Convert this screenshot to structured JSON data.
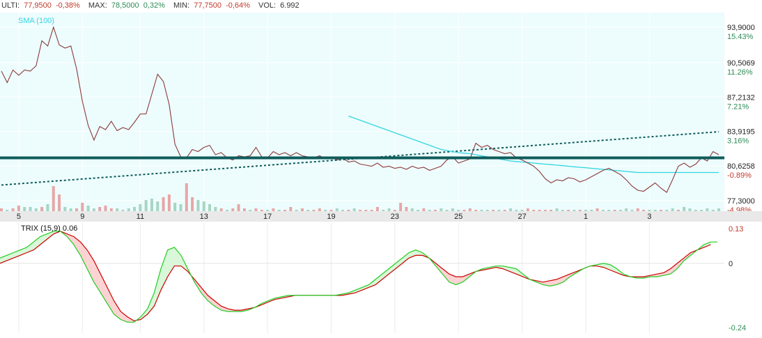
{
  "header": {
    "last_label": "ULTI:",
    "last_value": "77,9500",
    "last_change": "-0,38%",
    "max_label": "MAX:",
    "max_value": "78,5000",
    "max_change": "0,32%",
    "min_label": "MIN:",
    "min_value": "77,7500",
    "min_change": "-0,64%",
    "vol_label": "VOL:",
    "vol_value": "6.992"
  },
  "colors": {
    "down": "#c0392b",
    "up": "#2e8b57",
    "price_line": "#8b3a3a",
    "sma": "#33d6e0",
    "trend_line": "#0f5c5c",
    "support_line": "#0f5c5c",
    "plot_bg": "#edfcfd",
    "trix": "#22cc22",
    "trix_signal": "#cc0000",
    "fill_up": "#d9f7d9",
    "fill_down": "#fbd3d3",
    "vol_up": "#a8d5c3",
    "vol_down": "#e8a6a6"
  },
  "chart_data": [
    {
      "type": "line",
      "title": "",
      "sma_label": "SMA (100)",
      "x_tick_labels": [
        "5",
        "9",
        "11",
        "13",
        "17",
        "19",
        "23",
        "25",
        "27",
        "1",
        "3"
      ],
      "x_tick_index": [
        3,
        14,
        24,
        35,
        46,
        57,
        68,
        79,
        90,
        101,
        112
      ],
      "ylim": [
        76.3,
        95.3
      ],
      "y_ticks": [
        {
          "value": 93.9,
          "label": "93,9000",
          "pct": "15.43%"
        },
        {
          "value": 90.5069,
          "label": "90,5069",
          "pct": "11.26%"
        },
        {
          "value": 87.2132,
          "label": "87,2132",
          "pct": "7.21%"
        },
        {
          "value": 83.9195,
          "label": "83,9195",
          "pct": "3.16%"
        },
        {
          "value": 80.6258,
          "label": "80,6258",
          "pct": "-0.89%"
        },
        {
          "value": 77.3,
          "label": "77,3000",
          "pct": "-4.98%"
        }
      ],
      "price": [
        89.7,
        88.6,
        89.8,
        89.3,
        89.8,
        89.7,
        90.2,
        92.6,
        92.1,
        93.9,
        92.2,
        91.9,
        92.1,
        89.9,
        86.8,
        84.5,
        83.1,
        84.4,
        84.1,
        84.9,
        84.0,
        84.3,
        84.1,
        84.8,
        85.6,
        85.6,
        87.5,
        89.4,
        88.7,
        86.5,
        82.7,
        81.5,
        81.4,
        82.2,
        82.0,
        82.4,
        82.6,
        81.7,
        81.9,
        81.4,
        81.2,
        81.6,
        81.5,
        81.6,
        82.4,
        81.5,
        81.4,
        82.0,
        81.7,
        81.9,
        81.6,
        81.9,
        81.6,
        81.5,
        81.4,
        81.6,
        81.3,
        81.5,
        81.2,
        81.4,
        81.0,
        81.1,
        80.8,
        80.7,
        80.6,
        80.9,
        80.5,
        80.6,
        80.4,
        80.5,
        80.3,
        80.6,
        80.4,
        80.5,
        80.2,
        80.4,
        80.6,
        81.2,
        81.5,
        80.9,
        81.1,
        81.3,
        82.8,
        82.4,
        82.6,
        82.2,
        82.0,
        81.8,
        81.9,
        81.4,
        81.2,
        80.9,
        80.6,
        80.1,
        79.4,
        79.0,
        79.3,
        79.2,
        79.5,
        79.4,
        79.1,
        79.3,
        79.6,
        79.9,
        80.2,
        80.4,
        80.1,
        79.8,
        79.3,
        78.7,
        78.3,
        78.2,
        78.6,
        79.0,
        78.5,
        78.1,
        79.3,
        80.6,
        80.9,
        80.5,
        80.8,
        81.4,
        81.1,
        82.0,
        81.7
      ],
      "sma": [
        null,
        null,
        null,
        null,
        null,
        null,
        null,
        null,
        null,
        null,
        null,
        null,
        null,
        null,
        null,
        null,
        null,
        null,
        null,
        null,
        null,
        null,
        null,
        null,
        null,
        null,
        null,
        null,
        null,
        null,
        null,
        null,
        null,
        null,
        null,
        null,
        null,
        null,
        null,
        null,
        null,
        null,
        null,
        null,
        null,
        null,
        null,
        null,
        null,
        null,
        null,
        null,
        null,
        null,
        null,
        null,
        null,
        null,
        null,
        null,
        85.4,
        85.2,
        85.0,
        84.8,
        84.6,
        84.4,
        84.2,
        84.0,
        83.8,
        83.6,
        83.4,
        83.2,
        83.0,
        82.8,
        82.6,
        82.4,
        82.2,
        82.1,
        82.0,
        81.9,
        81.85,
        81.8,
        81.7,
        81.6,
        81.5,
        81.4,
        81.3,
        81.2,
        81.1,
        81.05,
        81.0,
        80.95,
        80.9,
        80.85,
        80.8,
        80.75,
        80.7,
        80.65,
        80.6,
        80.55,
        80.5,
        80.45,
        80.4,
        80.35,
        80.3,
        80.25,
        80.2,
        80.15,
        80.1,
        80.05,
        80.0,
        80.0,
        80.0,
        80.0,
        80.0,
        80.0,
        80.0,
        80.0,
        80.0,
        80.0,
        80.0,
        80.0,
        80.0,
        80.0,
        80.0
      ],
      "trend_line": [
        [
          0,
          78.8
        ],
        [
          124,
          83.9
        ]
      ],
      "support_level": 81.4,
      "volume": [
        2,
        1,
        2,
        4,
        3,
        3,
        2,
        3,
        5,
        18,
        12,
        3,
        2,
        2,
        6,
        4,
        2,
        3,
        4,
        2,
        2,
        1,
        2,
        3,
        5,
        8,
        9,
        7,
        10,
        12,
        6,
        5,
        20,
        10,
        8,
        7,
        5,
        3,
        2,
        1,
        2,
        5,
        2,
        1,
        2,
        1,
        1,
        2,
        1,
        1,
        3,
        1,
        2,
        1,
        1,
        2,
        1,
        1,
        2,
        1,
        1,
        2,
        1,
        1,
        1,
        3,
        1,
        2,
        1,
        6,
        3,
        2,
        1,
        2,
        1,
        1,
        2,
        1,
        2,
        1,
        1,
        2,
        1,
        1,
        1,
        1,
        1,
        1,
        2,
        1,
        1,
        2,
        1,
        1,
        1,
        1,
        2,
        1,
        1,
        1,
        1,
        1,
        1,
        2,
        1,
        1,
        1,
        1,
        2,
        1,
        2,
        1,
        1,
        1,
        1,
        1,
        2,
        1,
        3,
        2,
        1,
        1,
        2,
        1,
        2
      ],
      "volume_up": [
        false,
        true,
        false,
        false,
        true,
        true,
        true,
        false,
        true,
        false,
        false,
        true,
        true,
        false,
        false,
        true,
        true,
        false,
        false,
        false,
        true,
        true,
        true,
        true,
        true,
        true,
        true,
        true,
        false,
        false,
        true,
        true,
        false,
        false,
        true,
        true,
        true,
        true,
        false,
        true,
        false,
        false,
        false,
        true,
        false,
        false,
        true,
        false,
        true,
        false,
        false,
        true,
        false,
        true,
        false,
        false,
        true,
        false,
        true,
        true,
        false,
        true,
        false,
        false,
        false,
        false,
        true,
        true,
        false,
        false,
        false,
        true,
        true,
        false,
        true,
        false,
        true,
        true,
        true,
        true,
        false,
        false,
        false,
        true,
        true,
        false,
        true,
        false,
        true,
        true,
        true,
        false,
        false,
        false,
        false,
        false,
        true,
        true,
        false,
        true,
        false,
        true,
        true,
        false,
        true,
        true,
        false,
        true,
        true,
        true,
        false,
        false,
        true,
        true,
        false,
        true,
        true,
        false,
        true,
        true,
        true,
        true,
        true,
        true,
        true
      ]
    },
    {
      "type": "line",
      "title": "TRIX (15,9) 0.06",
      "ylim": [
        -0.24,
        0.13
      ],
      "y_tick_labels": [
        {
          "value": 0.13,
          "label": "0.13"
        },
        {
          "value": 0,
          "label": "0"
        },
        {
          "value": -0.24,
          "label": "-0.24"
        }
      ],
      "series": [
        {
          "name": "",
          "values": [
            0.02,
            0.03,
            0.04,
            0.05,
            0.06,
            0.08,
            0.1,
            0.11,
            0.12,
            0.12,
            0.1,
            0.07,
            0.03,
            -0.02,
            -0.07,
            -0.11,
            -0.15,
            -0.19,
            -0.21,
            -0.22,
            -0.22,
            -0.2,
            -0.17,
            -0.11,
            -0.02,
            0.05,
            0.06,
            0.03,
            -0.02,
            -0.07,
            -0.11,
            -0.14,
            -0.16,
            -0.175,
            -0.18,
            -0.18,
            -0.18,
            -0.175,
            -0.165,
            -0.15,
            -0.14,
            -0.13,
            -0.125,
            -0.12,
            -0.12,
            -0.12,
            -0.12,
            -0.12,
            -0.12,
            -0.12,
            -0.12,
            -0.115,
            -0.11,
            -0.1,
            -0.09,
            -0.08,
            -0.06,
            -0.04,
            -0.02,
            0.0,
            0.02,
            0.04,
            0.05,
            0.04,
            0.02,
            -0.01,
            -0.04,
            -0.07,
            -0.08,
            -0.07,
            -0.05,
            -0.03,
            -0.02,
            -0.015,
            -0.01,
            -0.01,
            -0.015,
            -0.02,
            -0.04,
            -0.06,
            -0.07,
            -0.08,
            -0.085,
            -0.08,
            -0.07,
            -0.05,
            -0.035,
            -0.02,
            -0.01,
            -0.005,
            -0.0,
            -0.005,
            -0.02,
            -0.04,
            -0.05,
            -0.055,
            -0.055,
            -0.05,
            -0.05,
            -0.045,
            -0.04,
            -0.02,
            0.01,
            0.03,
            0.05,
            0.07,
            0.08,
            0.08
          ]
        },
        {
          "name": "",
          "values": [
            0.0,
            0.01,
            0.02,
            0.03,
            0.04,
            0.05,
            0.07,
            0.09,
            0.11,
            0.12,
            0.11,
            0.1,
            0.08,
            0.05,
            0.01,
            -0.04,
            -0.09,
            -0.14,
            -0.18,
            -0.2,
            -0.215,
            -0.21,
            -0.19,
            -0.16,
            -0.1,
            -0.05,
            -0.01,
            -0.01,
            -0.03,
            -0.06,
            -0.09,
            -0.12,
            -0.14,
            -0.16,
            -0.17,
            -0.175,
            -0.175,
            -0.17,
            -0.165,
            -0.155,
            -0.145,
            -0.135,
            -0.13,
            -0.125,
            -0.12,
            -0.12,
            -0.12,
            -0.12,
            -0.12,
            -0.12,
            -0.12,
            -0.12,
            -0.115,
            -0.11,
            -0.1,
            -0.09,
            -0.08,
            -0.06,
            -0.04,
            -0.02,
            0.0,
            0.02,
            0.03,
            0.03,
            0.02,
            0.0,
            -0.02,
            -0.04,
            -0.05,
            -0.05,
            -0.04,
            -0.03,
            -0.025,
            -0.02,
            -0.015,
            -0.02,
            -0.03,
            -0.04,
            -0.05,
            -0.06,
            -0.065,
            -0.07,
            -0.065,
            -0.06,
            -0.05,
            -0.04,
            -0.03,
            -0.02,
            -0.01,
            -0.01,
            -0.015,
            -0.025,
            -0.035,
            -0.045,
            -0.05,
            -0.05,
            -0.05,
            -0.045,
            -0.04,
            -0.035,
            -0.02,
            0.0,
            0.02,
            0.04,
            0.05,
            0.06,
            0.07
          ]
        }
      ]
    }
  ]
}
